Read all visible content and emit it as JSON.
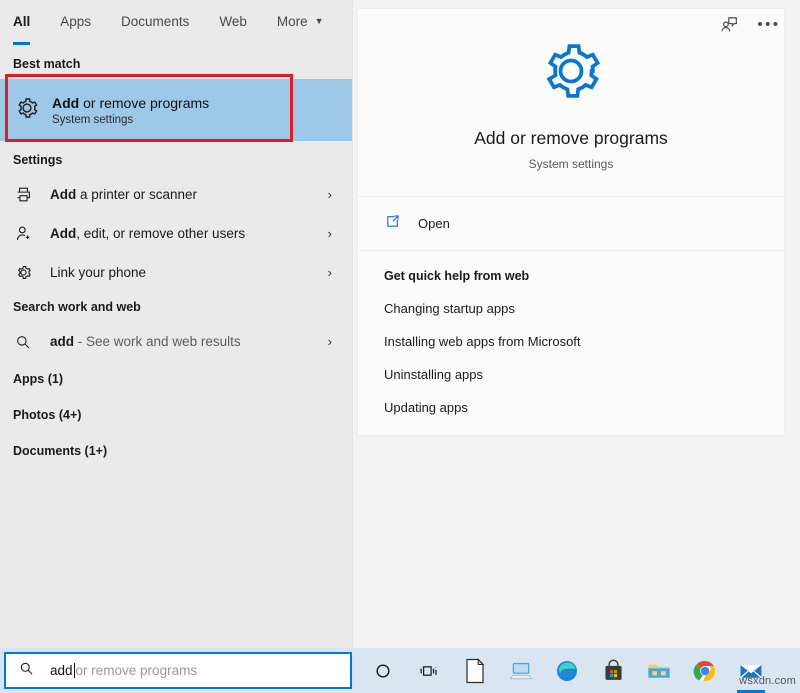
{
  "tabs": [
    {
      "label": "All",
      "active": true
    },
    {
      "label": "Apps",
      "active": false
    },
    {
      "label": "Documents",
      "active": false
    },
    {
      "label": "Web",
      "active": false
    },
    {
      "label": "More",
      "active": false,
      "caret": "▼"
    }
  ],
  "topright": {
    "feedback_icon": "person-feedback-icon",
    "more_label": "•••"
  },
  "left": {
    "best_match_heading": "Best match",
    "best_match": {
      "title_bold": "Add",
      "title_rest": " or remove programs",
      "subtitle": "System settings",
      "icon": "gear-icon",
      "highlight_color": "#9ec8e8",
      "annotation_color": "#e01b24"
    },
    "settings_heading": "Settings",
    "settings": [
      {
        "bold": "Add",
        "rest": " a printer or scanner",
        "icon": "printer-icon",
        "chevron": "›"
      },
      {
        "bold": "Add",
        "rest": ", edit, or remove other users",
        "icon": "add-user-icon",
        "chevron": "›"
      },
      {
        "bold": "",
        "rest": "Link your phone",
        "icon": "gear-icon",
        "chevron": "›"
      }
    ],
    "web_heading": "Search work and web",
    "web_result": {
      "query": "add",
      "suffix": " - See work and web results",
      "icon": "search-icon",
      "chevron": "›"
    },
    "categories": [
      {
        "label": "Apps (1)"
      },
      {
        "label": "Photos (4+)"
      },
      {
        "label": "Documents (1+)"
      }
    ]
  },
  "right": {
    "hero": {
      "icon": "gear-icon",
      "icon_color": "#0a76d0",
      "title": "Add or remove programs",
      "subtitle": "System settings"
    },
    "open": {
      "label": "Open",
      "icon": "open-external-icon"
    },
    "help_title": "Get quick help from web",
    "help_links": [
      "Changing startup apps",
      "Installing web apps from Microsoft",
      "Uninstalling apps",
      "Updating apps"
    ]
  },
  "taskbar": {
    "search": {
      "icon": "search-icon",
      "typed_value": "add",
      "suggestion": "or remove programs"
    },
    "items": [
      {
        "name": "cortana-icon",
        "active": false
      },
      {
        "name": "task-view-icon",
        "active": false
      },
      {
        "name": "document-app-icon",
        "active": false
      },
      {
        "name": "remote-desktop-icon",
        "active": false
      },
      {
        "name": "edge-browser-icon",
        "active": false
      },
      {
        "name": "microsoft-store-icon",
        "active": false
      },
      {
        "name": "file-explorer-icon",
        "active": false
      },
      {
        "name": "chrome-browser-icon",
        "active": false
      },
      {
        "name": "mail-app-icon",
        "active": true
      }
    ]
  },
  "watermark": "wsxdn.com"
}
